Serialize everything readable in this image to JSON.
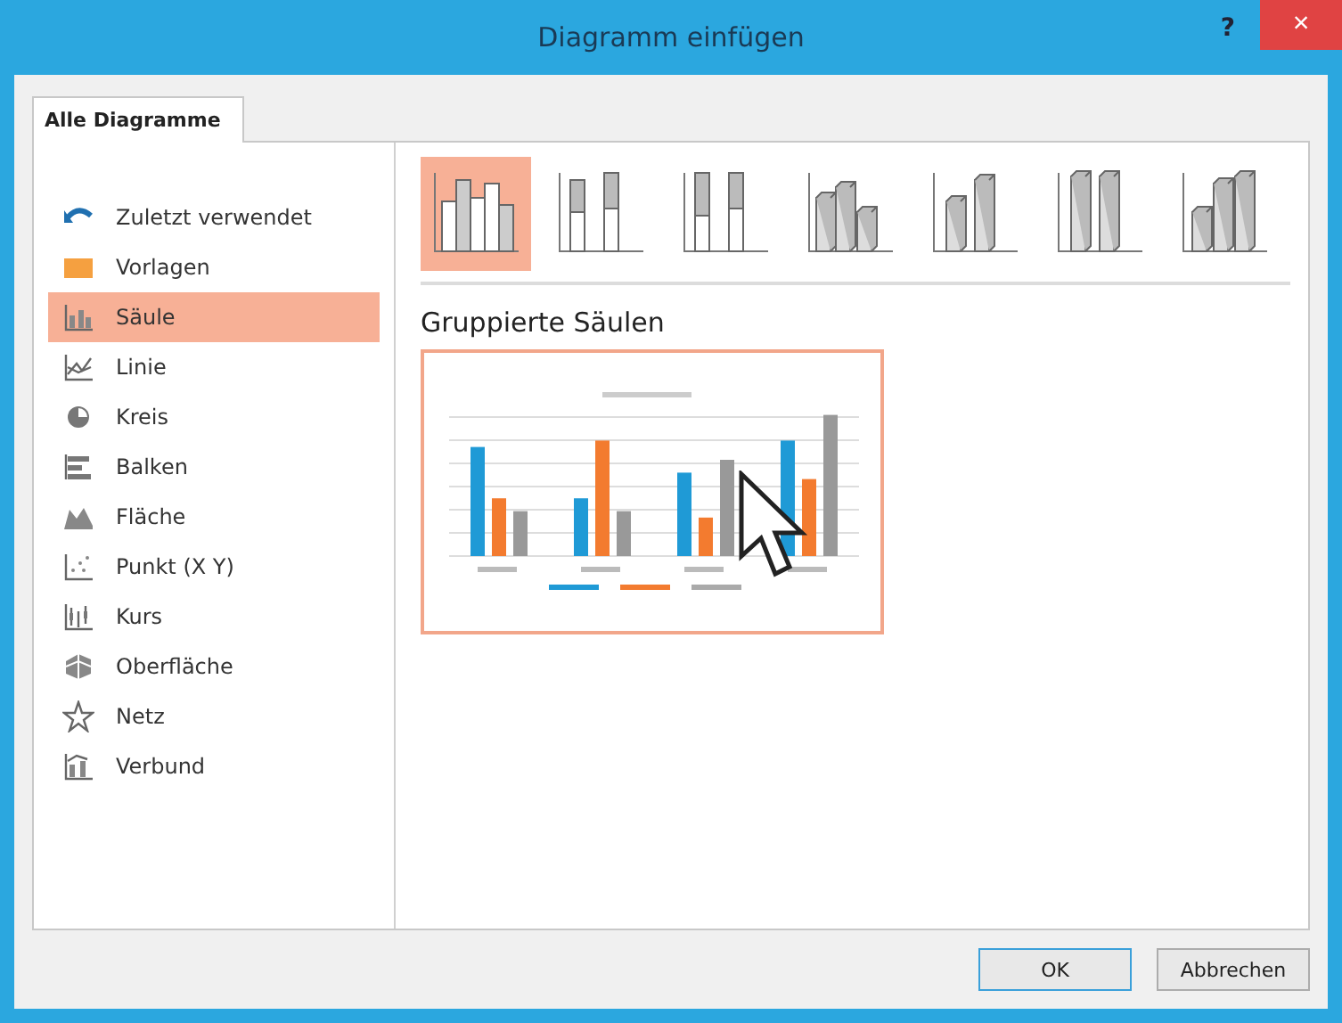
{
  "window": {
    "title": "Diagramm einfügen",
    "help": "?",
    "close": "×"
  },
  "tabs": [
    {
      "label": "Alle Diagramme",
      "selected": true
    }
  ],
  "sidebar": {
    "items": [
      {
        "label": "Zuletzt verwendet",
        "kind": "recent",
        "selected": false
      },
      {
        "label": "Vorlagen",
        "kind": "folder",
        "selected": false
      },
      {
        "label": "Säule",
        "kind": "column",
        "selected": true
      },
      {
        "label": "Linie",
        "kind": "line",
        "selected": false
      },
      {
        "label": "Kreis",
        "kind": "pie",
        "selected": false
      },
      {
        "label": "Balken",
        "kind": "bar",
        "selected": false
      },
      {
        "label": "Fläche",
        "kind": "area",
        "selected": false
      },
      {
        "label": "Punkt (X Y)",
        "kind": "scatter",
        "selected": false
      },
      {
        "label": "Kurs",
        "kind": "stock",
        "selected": false
      },
      {
        "label": "Oberfläche",
        "kind": "surface",
        "selected": false
      },
      {
        "label": "Netz",
        "kind": "radar",
        "selected": false
      },
      {
        "label": "Verbund",
        "kind": "combo",
        "selected": false
      }
    ]
  },
  "subtypes": [
    {
      "kind": "clustered",
      "selected": true
    },
    {
      "kind": "stacked",
      "selected": false
    },
    {
      "kind": "stacked100",
      "selected": false
    },
    {
      "kind": "clustered3d",
      "selected": false
    },
    {
      "kind": "stacked3d",
      "selected": false
    },
    {
      "kind": "stacked100_3d",
      "selected": false
    },
    {
      "kind": "column3d",
      "selected": false
    }
  ],
  "subtype_title": "Gruppierte Säulen",
  "buttons": [
    {
      "label": "OK",
      "kind": "default"
    },
    {
      "label": "Abbrechen",
      "kind": "normal"
    }
  ]
}
